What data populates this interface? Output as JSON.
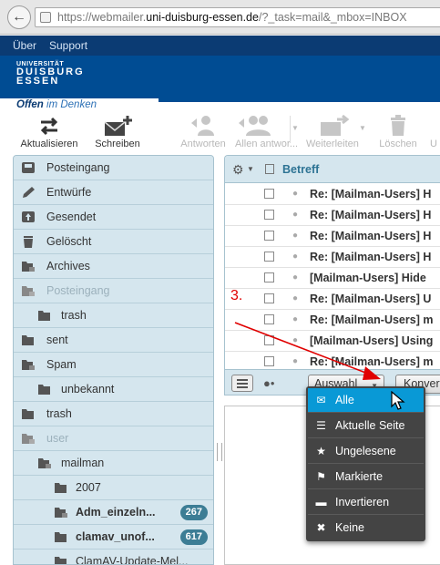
{
  "browser": {
    "url_prefix": "https://webmailer.",
    "url_host": "uni-duisburg-essen.de",
    "url_path": "/?_task=mail&_mbox=INBOX"
  },
  "topnav": {
    "about": "Über",
    "support": "Support"
  },
  "header": {
    "logo_line1": "UNIVERSITÄT",
    "logo_line2": "DUISBURG",
    "logo_line3": "ESSEN",
    "slogan_bold": "Offen",
    "slogan_rest": " im Denken"
  },
  "toolbar": {
    "refresh": "Aktualisieren",
    "compose": "Schreiben",
    "reply": "Antworten",
    "reply_all": "Allen antwor...",
    "forward": "Weiterleiten",
    "delete": "Löschen",
    "more": "U"
  },
  "folders": [
    {
      "label": "Posteingang",
      "icon": "inbox-icon"
    },
    {
      "label": "Entwürfe",
      "icon": "pencil-icon"
    },
    {
      "label": "Gesendet",
      "icon": "sent-icon"
    },
    {
      "label": "Gelöscht",
      "icon": "trash-icon"
    },
    {
      "label": "Archives",
      "icon": "folder-icon"
    },
    {
      "label": "Posteingang",
      "icon": "folder-icon"
    },
    {
      "label": "trash",
      "icon": "folder-icon"
    },
    {
      "label": "sent",
      "icon": "folder-icon"
    },
    {
      "label": "Spam",
      "icon": "folder-icon"
    },
    {
      "label": "unbekannt",
      "icon": "folder-icon"
    },
    {
      "label": "trash",
      "icon": "folder-icon"
    },
    {
      "label": "user",
      "icon": "folder-icon"
    },
    {
      "label": "mailman",
      "icon": "folder-icon"
    },
    {
      "label": "2007",
      "icon": "folder-icon"
    },
    {
      "label": "Adm_einzeln...",
      "icon": "folder-icon",
      "count": "267"
    },
    {
      "label": "clamav_unof...",
      "icon": "folder-icon",
      "count": "617"
    },
    {
      "label": "ClamAV-Update-Mel...",
      "icon": "folder-icon"
    }
  ],
  "messages": {
    "column_subject": "Betreff",
    "rows": [
      "Re: [Mailman-Users] H",
      "Re: [Mailman-Users] H",
      "Re: [Mailman-Users] H",
      "Re: [Mailman-Users] H",
      "[Mailman-Users] Hide",
      "Re: [Mailman-Users] U",
      "Re: [Mailman-Users] m",
      "[Mailman-Users] Using",
      "Re: [Mailman-Users] m"
    ],
    "select_button": "Auswahl",
    "threads_button": "Konver"
  },
  "annotation": {
    "step": "3."
  },
  "select_menu": [
    {
      "label": "Alle",
      "icon": "envelope-icon"
    },
    {
      "label": "Aktuelle Seite",
      "icon": "list-icon"
    },
    {
      "label": "Ungelesene",
      "icon": "star-icon"
    },
    {
      "label": "Markierte",
      "icon": "flag-icon"
    },
    {
      "label": "Invertieren",
      "icon": "invert-icon"
    },
    {
      "label": "Keine",
      "icon": "x-icon"
    }
  ],
  "colors": {
    "brand_blue": "#004c93",
    "panel_bg": "#d5e6ee",
    "menu_bg": "#444444",
    "menu_selected": "#0999d6",
    "annotation_red": "#e00000"
  }
}
